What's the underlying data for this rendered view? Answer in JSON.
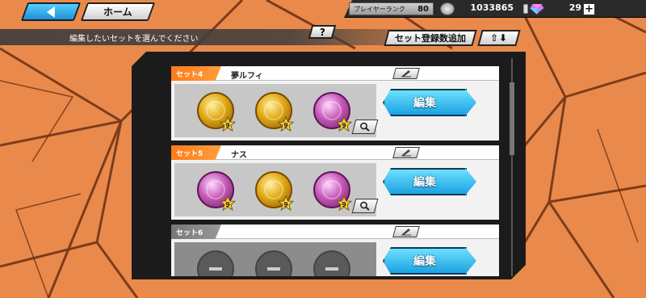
{
  "header": {
    "home_label": "ホーム",
    "rank_label": "プレイヤーランク",
    "rank_value": "80",
    "coin_value": "1033865",
    "gem_value": "29",
    "plus_label": "+"
  },
  "toolbar": {
    "instruction": "編集したいセットを選んでください",
    "help_label": "?",
    "add_set_label": "セット登録数追加",
    "sort_label": "⇧⬇"
  },
  "sets": [
    {
      "tag": "セット4",
      "name": "夢ルフィ",
      "medals": [
        {
          "type": "gold",
          "stars": "9"
        },
        {
          "type": "gold",
          "stars": "9"
        },
        {
          "type": "pink",
          "stars": "9"
        }
      ],
      "edit_label": "編集"
    },
    {
      "tag": "セット5",
      "name": "ナス",
      "medals": [
        {
          "type": "pink",
          "stars": "9"
        },
        {
          "type": "gold",
          "stars": "9"
        },
        {
          "type": "pink",
          "stars": "9"
        }
      ],
      "edit_label": "編集"
    },
    {
      "tag": "セット6",
      "name": "",
      "medals": [
        {
          "type": "empty"
        },
        {
          "type": "empty"
        },
        {
          "type": "empty"
        }
      ],
      "edit_label": "編集"
    }
  ],
  "colors": {
    "background": "#e98a4c",
    "accent_blue": "#19a2e0",
    "set_tag_orange": "#ff7a1a",
    "gold_medal": "#e0a814",
    "pink_medal": "#c75ab8"
  }
}
